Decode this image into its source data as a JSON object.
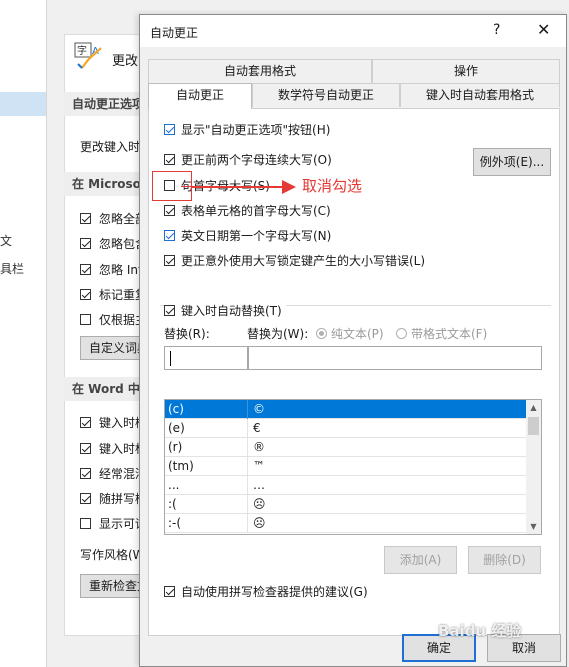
{
  "background_window": {
    "left_partial_items": [
      "文",
      "具栏"
    ],
    "header_title": "更改",
    "sections": [
      {
        "title": "自动更正选项"
      },
      {
        "title": "在 Microsoft"
      },
      {
        "title": "在 Word 中"
      }
    ],
    "autocorrect_text": "更改键入时",
    "spell_items": [
      {
        "label": "忽略全部",
        "checked": true
      },
      {
        "label": "忽略包含",
        "checked": true
      },
      {
        "label": "忽略 Int",
        "checked": true
      },
      {
        "label": "标记重复",
        "checked": true
      },
      {
        "label": "仅根据主",
        "checked": false
      }
    ],
    "custom_dict_button": "自定义词典",
    "word_items": [
      {
        "label": "键入时检",
        "checked": true
      },
      {
        "label": "键入时标",
        "checked": true
      },
      {
        "label": "经常混淆",
        "checked": true
      },
      {
        "label": "随拼写检",
        "checked": true
      },
      {
        "label": "显示可读",
        "checked": false
      }
    ],
    "writing_style_label": "写作风格(W",
    "recheck_button": "重新检查文"
  },
  "dialog": {
    "title": "自动更正",
    "help_label": "?",
    "close_label": "✕",
    "tabs_row1": [
      "自动套用格式",
      "操作"
    ],
    "tabs_row2": [
      {
        "label": "自动更正",
        "active": true
      },
      {
        "label": "数学符号自动更正",
        "active": false
      },
      {
        "label": "键入时自动套用格式",
        "active": false
      }
    ],
    "options": [
      {
        "label": "显示\"自动更正选项\"按钮(H)",
        "checked": true,
        "style": "blue"
      },
      {
        "label": "更正前两个字母连续大写(O)",
        "checked": true,
        "style": "normal"
      },
      {
        "label": "句首字母大写(S)",
        "checked": false,
        "style": "normal"
      },
      {
        "label": "表格单元格的首字母大写(C)",
        "checked": true,
        "style": "normal"
      },
      {
        "label": "英文日期第一个字母大写(N)",
        "checked": true,
        "style": "blue"
      },
      {
        "label": "更正意外使用大写锁定键产生的大小写错误(L)",
        "checked": true,
        "style": "normal"
      }
    ],
    "exceptions_button": "例外项(E)...",
    "replace_as_type": {
      "label": "键入时自动替换(T)",
      "checked": true
    },
    "replace_label": "替换(R):",
    "with_label": "替换为(W):",
    "plain_text": "纯文本(P)",
    "formatted_text": "带格式文本(F)",
    "replace_value": "",
    "with_value": "",
    "entries": [
      {
        "from": "(c)",
        "to": "©",
        "selected": true
      },
      {
        "from": "(e)",
        "to": "€",
        "selected": false
      },
      {
        "from": "(r)",
        "to": "®",
        "selected": false
      },
      {
        "from": "(tm)",
        "to": "™",
        "selected": false
      },
      {
        "from": "...",
        "to": "…",
        "selected": false
      },
      {
        "from": ":(",
        "to": "☹",
        "selected": false
      },
      {
        "from": ":-(",
        "to": "☹",
        "selected": false
      }
    ],
    "add_button": "添加(A)",
    "delete_button": "删除(D)",
    "spell_suggest": {
      "label": "自动使用拼写检查器提供的建议(G)",
      "checked": true
    },
    "ok_button": "确定",
    "cancel_button": "取消"
  },
  "annotation": {
    "text": "取消勾选",
    "color": "#e53935"
  },
  "watermark": "Baidu 经验",
  "colors": {
    "selection": "#0078d7",
    "checkbox_blue": "#1e6fd1",
    "annotation_red": "#e53935"
  }
}
